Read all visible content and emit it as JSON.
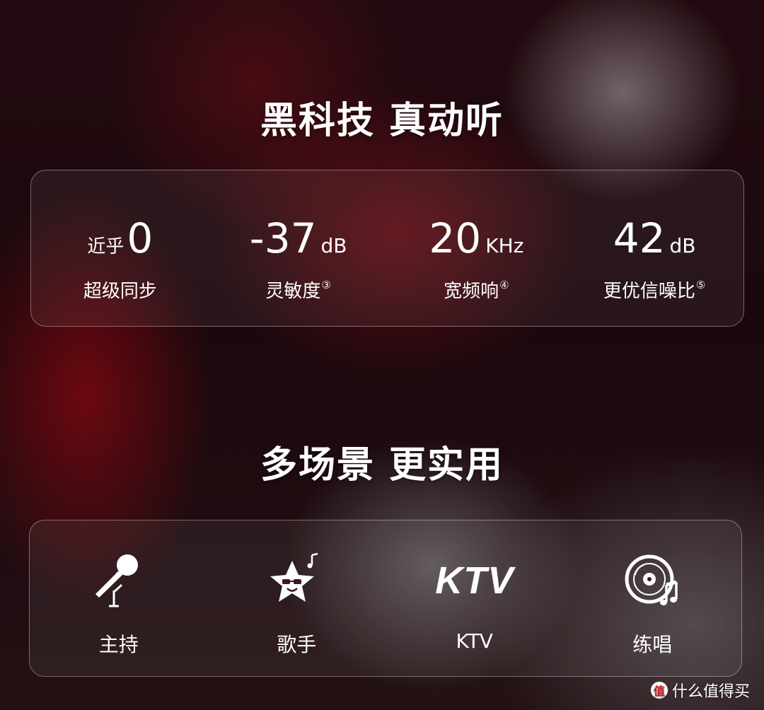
{
  "section1": {
    "title": "黑科技 真动听",
    "stats": [
      {
        "prefix": "近乎",
        "value": "0",
        "unit": "",
        "label": "超级同步",
        "note": ""
      },
      {
        "prefix": "",
        "value": "-37",
        "unit": "dB",
        "label": "灵敏度",
        "note": "③"
      },
      {
        "prefix": "",
        "value": "20",
        "unit": "KHz",
        "label": "宽频响",
        "note": "④"
      },
      {
        "prefix": "",
        "value": "42",
        "unit": "dB",
        "label": "更优信噪比",
        "note": "⑤"
      }
    ]
  },
  "section2": {
    "title": "多场景 更实用",
    "scenes": [
      {
        "icon": "microphone-icon",
        "label": "主持"
      },
      {
        "icon": "singer-star-icon",
        "label": "歌手"
      },
      {
        "icon": "ktv-icon",
        "icon_text": "KTV",
        "label": "KTV"
      },
      {
        "icon": "music-disc-icon",
        "label": "练唱"
      }
    ]
  },
  "watermark": {
    "badge": "值",
    "text": "什么值得买"
  }
}
